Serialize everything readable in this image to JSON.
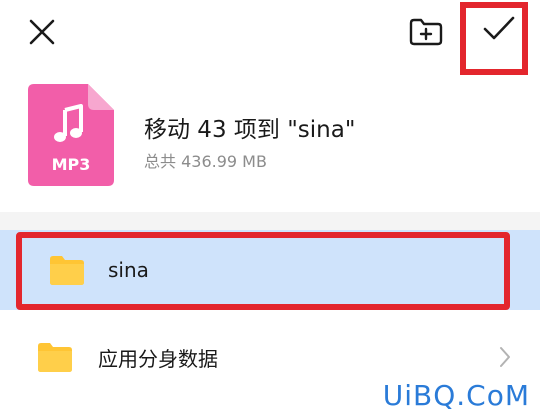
{
  "top_bar": {
    "close_icon": "close-icon",
    "new_folder_icon": "new-folder-icon",
    "confirm_icon": "checkmark-icon"
  },
  "file_summary": {
    "file_badge": "MP3",
    "title": "移动 43 项到 \"sina\"",
    "subtitle": "总共 436.99 MB",
    "icon_color": "#f25ea9"
  },
  "folders": [
    {
      "label": "sina",
      "selected": true,
      "icon": "folder-icon"
    },
    {
      "label": "应用分身数据",
      "selected": false,
      "icon": "folder-icon",
      "has_chevron": true
    }
  ],
  "colors": {
    "selected_row_bg": "#cfe3fb",
    "highlight_border": "#e3262d",
    "folder_yellow": "#ffc534",
    "watermark": "#2a7bd8"
  },
  "watermark": {
    "text": "UiBQ.CoM"
  }
}
